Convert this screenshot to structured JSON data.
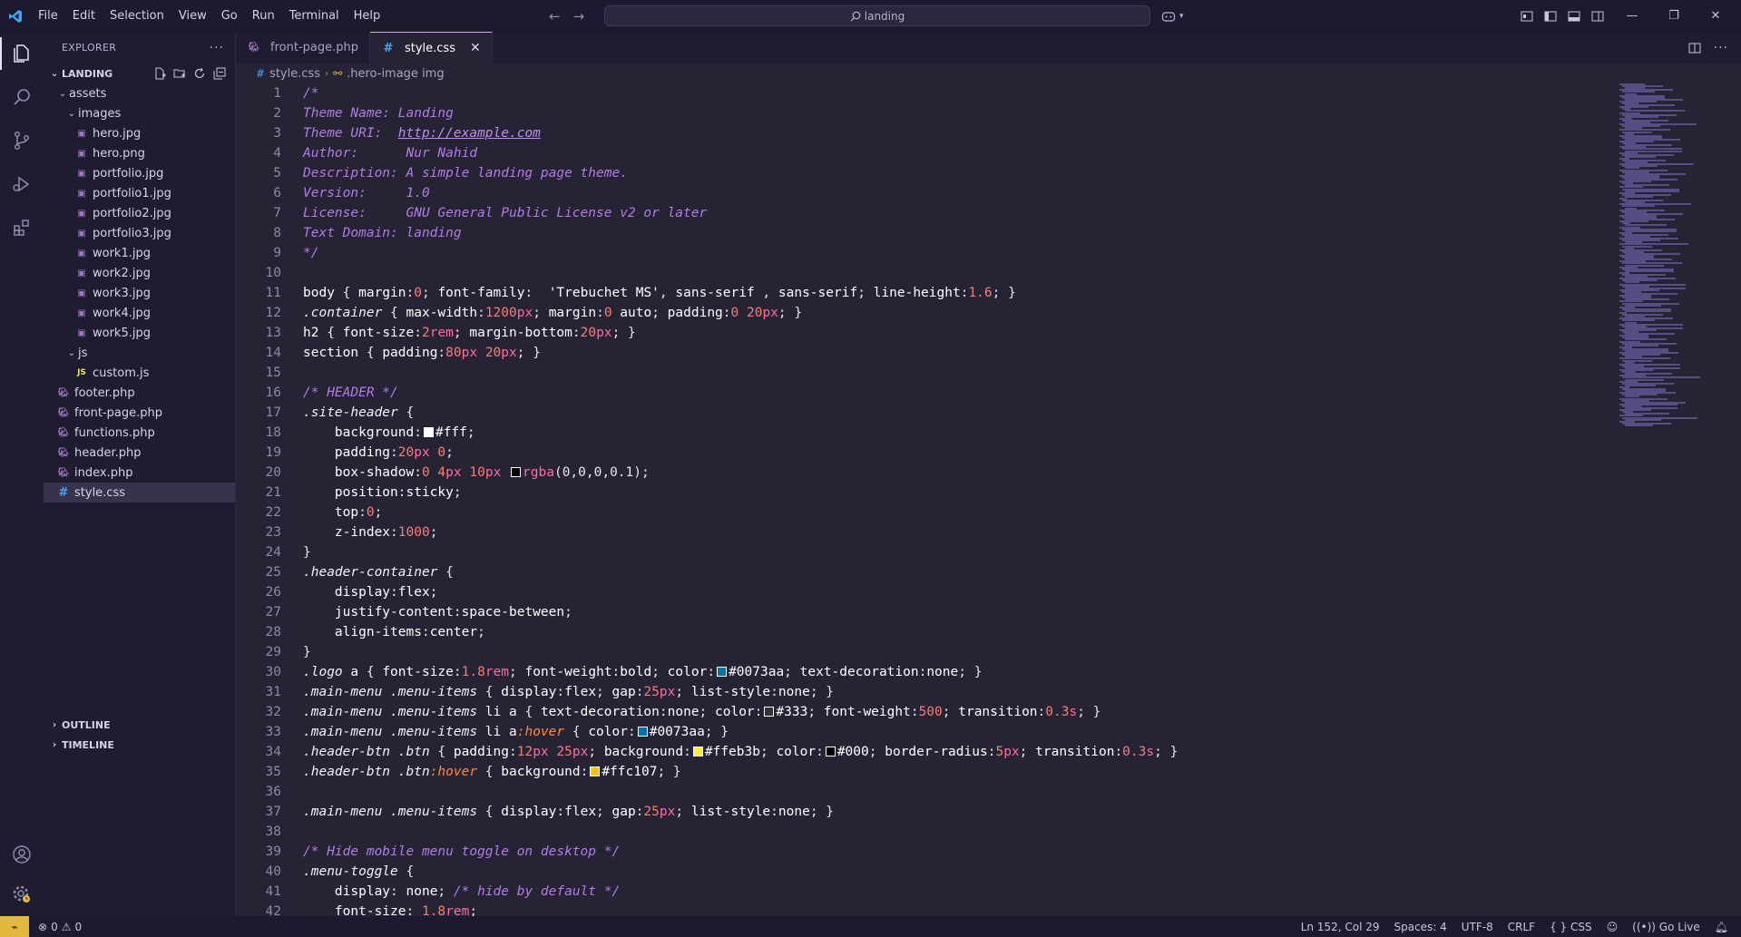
{
  "menu": [
    "File",
    "Edit",
    "Selection",
    "View",
    "Go",
    "Run",
    "Terminal",
    "Help"
  ],
  "search": {
    "text": "landing"
  },
  "sidebar": {
    "title": "EXPLORER",
    "root": "LANDING",
    "tree": [
      {
        "label": "assets",
        "type": "folder",
        "depth": 1
      },
      {
        "label": "images",
        "type": "folder",
        "depth": 2
      },
      {
        "label": "hero.jpg",
        "type": "img",
        "depth": 3
      },
      {
        "label": "hero.png",
        "type": "img",
        "depth": 3
      },
      {
        "label": "portfolio.jpg",
        "type": "img",
        "depth": 3
      },
      {
        "label": "portfolio1.jpg",
        "type": "img",
        "depth": 3
      },
      {
        "label": "portfolio2.jpg",
        "type": "img",
        "depth": 3
      },
      {
        "label": "portfolio3.jpg",
        "type": "img",
        "depth": 3
      },
      {
        "label": "work1.jpg",
        "type": "img",
        "depth": 3
      },
      {
        "label": "work2.jpg",
        "type": "img",
        "depth": 3
      },
      {
        "label": "work3.jpg",
        "type": "img",
        "depth": 3
      },
      {
        "label": "work4.jpg",
        "type": "img",
        "depth": 3
      },
      {
        "label": "work5.jpg",
        "type": "img",
        "depth": 3
      },
      {
        "label": "js",
        "type": "folder",
        "depth": 2
      },
      {
        "label": "custom.js",
        "type": "js",
        "depth": 3
      },
      {
        "label": "footer.php",
        "type": "php",
        "depth": 1
      },
      {
        "label": "front-page.php",
        "type": "php",
        "depth": 1
      },
      {
        "label": "functions.php",
        "type": "php",
        "depth": 1
      },
      {
        "label": "header.php",
        "type": "php",
        "depth": 1
      },
      {
        "label": "index.php",
        "type": "php",
        "depth": 1
      },
      {
        "label": "style.css",
        "type": "css",
        "depth": 1,
        "selected": true
      }
    ],
    "outline": "OUTLINE",
    "timeline": "TIMELINE"
  },
  "tabs": [
    {
      "label": "front-page.php",
      "icon": "php",
      "active": false
    },
    {
      "label": "style.css",
      "icon": "css",
      "active": true
    }
  ],
  "breadcrumb": {
    "file": "style.css",
    "symbol": ".hero-image img"
  },
  "colors": {
    "white": "#ffffff",
    "blue": "#0073aa",
    "dark": "#333333",
    "black": "#000000",
    "yellow": "#ffeb3b",
    "amber": "#ffc107",
    "accent": "#e2b93d"
  },
  "code": [
    [
      [
        "c",
        "/*"
      ]
    ],
    [
      [
        "c",
        "Theme Name: Landing"
      ]
    ],
    [
      [
        "c",
        "Theme URI:  "
      ],
      [
        "url",
        "http://example.com"
      ]
    ],
    [
      [
        "c",
        "Author:      Nur Nahid"
      ]
    ],
    [
      [
        "c",
        "Description: A simple landing page theme."
      ]
    ],
    [
      [
        "c",
        "Version:     1.0"
      ]
    ],
    [
      [
        "c",
        "License:     GNU General Public License v2 or later"
      ]
    ],
    [
      [
        "c",
        "Text Domain: landing"
      ]
    ],
    [
      [
        "c",
        "*/"
      ]
    ],
    [],
    [
      [
        "sel",
        "body"
      ],
      [
        "pun",
        " { "
      ],
      [
        "prop",
        "margin"
      ],
      [
        "pun",
        ":"
      ],
      [
        "num",
        "0"
      ],
      [
        "pun",
        "; "
      ],
      [
        "prop",
        "font-family"
      ],
      [
        "pun",
        ":  "
      ],
      [
        "str",
        "'Trebuchet MS'"
      ],
      [
        "pun",
        ", "
      ],
      [
        "val",
        "sans-serif"
      ],
      [
        "pun",
        " , "
      ],
      [
        "val",
        "sans-serif"
      ],
      [
        "pun",
        "; "
      ],
      [
        "prop",
        "line-height"
      ],
      [
        "pun",
        ":"
      ],
      [
        "num",
        "1.6"
      ],
      [
        "pun",
        "; }"
      ]
    ],
    [
      [
        "cls",
        ".container"
      ],
      [
        "pun",
        " { "
      ],
      [
        "prop",
        "max-width"
      ],
      [
        "pun",
        ":"
      ],
      [
        "num",
        "1200"
      ],
      [
        "unit",
        "px"
      ],
      [
        "pun",
        "; "
      ],
      [
        "prop",
        "margin"
      ],
      [
        "pun",
        ":"
      ],
      [
        "num",
        "0"
      ],
      [
        "val",
        " auto"
      ],
      [
        "pun",
        "; "
      ],
      [
        "prop",
        "padding"
      ],
      [
        "pun",
        ":"
      ],
      [
        "num",
        "0"
      ],
      [
        "num",
        " 20"
      ],
      [
        "unit",
        "px"
      ],
      [
        "pun",
        "; }"
      ]
    ],
    [
      [
        "sel",
        "h2"
      ],
      [
        "pun",
        " { "
      ],
      [
        "prop",
        "font-size"
      ],
      [
        "pun",
        ":"
      ],
      [
        "num",
        "2"
      ],
      [
        "unit",
        "rem"
      ],
      [
        "pun",
        "; "
      ],
      [
        "prop",
        "margin-bottom"
      ],
      [
        "pun",
        ":"
      ],
      [
        "num",
        "20"
      ],
      [
        "unit",
        "px"
      ],
      [
        "pun",
        "; }"
      ]
    ],
    [
      [
        "sel",
        "section"
      ],
      [
        "pun",
        " { "
      ],
      [
        "prop",
        "padding"
      ],
      [
        "pun",
        ":"
      ],
      [
        "num",
        "80"
      ],
      [
        "unit",
        "px"
      ],
      [
        "num",
        " 20"
      ],
      [
        "unit",
        "px"
      ],
      [
        "pun",
        "; }"
      ]
    ],
    [],
    [
      [
        "c",
        "/* HEADER */"
      ]
    ],
    [
      [
        "cls",
        ".site-header"
      ],
      [
        "pun",
        " {"
      ]
    ],
    [
      [
        "pun",
        "    "
      ],
      [
        "prop",
        "background"
      ],
      [
        "pun",
        ":"
      ],
      [
        "sw",
        "white"
      ],
      [
        "val",
        "#fff"
      ],
      [
        "pun",
        ";"
      ]
    ],
    [
      [
        "pun",
        "    "
      ],
      [
        "prop",
        "padding"
      ],
      [
        "pun",
        ":"
      ],
      [
        "num",
        "20"
      ],
      [
        "unit",
        "px"
      ],
      [
        "num",
        " 0"
      ],
      [
        "pun",
        ";"
      ]
    ],
    [
      [
        "pun",
        "    "
      ],
      [
        "prop",
        "box-shadow"
      ],
      [
        "pun",
        ":"
      ],
      [
        "num",
        "0"
      ],
      [
        "num",
        " 4"
      ],
      [
        "unit",
        "px"
      ],
      [
        "num",
        " 10"
      ],
      [
        "unit",
        "px"
      ],
      [
        "pun",
        " "
      ],
      [
        "sw",
        "black"
      ],
      [
        "unit",
        "rgba"
      ],
      [
        "pun",
        "(0,0,0,0.1);"
      ]
    ],
    [
      [
        "pun",
        "    "
      ],
      [
        "prop",
        "position"
      ],
      [
        "pun",
        ":"
      ],
      [
        "val",
        "sticky"
      ],
      [
        "pun",
        ";"
      ]
    ],
    [
      [
        "pun",
        "    "
      ],
      [
        "prop",
        "top"
      ],
      [
        "pun",
        ":"
      ],
      [
        "num",
        "0"
      ],
      [
        "pun",
        ";"
      ]
    ],
    [
      [
        "pun",
        "    "
      ],
      [
        "prop",
        "z-index"
      ],
      [
        "pun",
        ":"
      ],
      [
        "num",
        "1000"
      ],
      [
        "pun",
        ";"
      ]
    ],
    [
      [
        "pun",
        "}"
      ]
    ],
    [
      [
        "cls",
        ".header-container"
      ],
      [
        "pun",
        " {"
      ]
    ],
    [
      [
        "pun",
        "    "
      ],
      [
        "prop",
        "display"
      ],
      [
        "pun",
        ":"
      ],
      [
        "val",
        "flex"
      ],
      [
        "pun",
        ";"
      ]
    ],
    [
      [
        "pun",
        "    "
      ],
      [
        "prop",
        "justify-content"
      ],
      [
        "pun",
        ":"
      ],
      [
        "val",
        "space-between"
      ],
      [
        "pun",
        ";"
      ]
    ],
    [
      [
        "pun",
        "    "
      ],
      [
        "prop",
        "align-items"
      ],
      [
        "pun",
        ":"
      ],
      [
        "val",
        "center"
      ],
      [
        "pun",
        ";"
      ]
    ],
    [
      [
        "pun",
        "}"
      ]
    ],
    [
      [
        "cls",
        ".logo"
      ],
      [
        "sel",
        " a"
      ],
      [
        "pun",
        " { "
      ],
      [
        "prop",
        "font-size"
      ],
      [
        "pun",
        ":"
      ],
      [
        "num",
        "1.8"
      ],
      [
        "unit",
        "rem"
      ],
      [
        "pun",
        "; "
      ],
      [
        "prop",
        "font-weight"
      ],
      [
        "pun",
        ":"
      ],
      [
        "val",
        "bold"
      ],
      [
        "pun",
        "; "
      ],
      [
        "prop",
        "color"
      ],
      [
        "pun",
        ":"
      ],
      [
        "sw",
        "blue"
      ],
      [
        "val",
        "#0073aa"
      ],
      [
        "pun",
        "; "
      ],
      [
        "prop",
        "text-decoration"
      ],
      [
        "pun",
        ":"
      ],
      [
        "val",
        "none"
      ],
      [
        "pun",
        "; }"
      ]
    ],
    [
      [
        "cls",
        ".main-menu"
      ],
      [
        "pun",
        " "
      ],
      [
        "cls",
        ".menu-items"
      ],
      [
        "pun",
        " { "
      ],
      [
        "prop",
        "display"
      ],
      [
        "pun",
        ":"
      ],
      [
        "val",
        "flex"
      ],
      [
        "pun",
        "; "
      ],
      [
        "prop",
        "gap"
      ],
      [
        "pun",
        ":"
      ],
      [
        "num",
        "25"
      ],
      [
        "unit",
        "px"
      ],
      [
        "pun",
        "; "
      ],
      [
        "prop",
        "list-style"
      ],
      [
        "pun",
        ":"
      ],
      [
        "val",
        "none"
      ],
      [
        "pun",
        "; }"
      ]
    ],
    [
      [
        "cls",
        ".main-menu"
      ],
      [
        "pun",
        " "
      ],
      [
        "cls",
        ".menu-items"
      ],
      [
        "sel",
        " li a"
      ],
      [
        "pun",
        " { "
      ],
      [
        "prop",
        "text-decoration"
      ],
      [
        "pun",
        ":"
      ],
      [
        "val",
        "none"
      ],
      [
        "pun",
        "; "
      ],
      [
        "prop",
        "color"
      ],
      [
        "pun",
        ":"
      ],
      [
        "sw",
        "dark"
      ],
      [
        "val",
        "#333"
      ],
      [
        "pun",
        "; "
      ],
      [
        "prop",
        "font-weight"
      ],
      [
        "pun",
        ":"
      ],
      [
        "num",
        "500"
      ],
      [
        "pun",
        "; "
      ],
      [
        "prop",
        "transition"
      ],
      [
        "pun",
        ":"
      ],
      [
        "num",
        "0.3"
      ],
      [
        "unit",
        "s"
      ],
      [
        "pun",
        "; }"
      ]
    ],
    [
      [
        "cls",
        ".main-menu"
      ],
      [
        "pun",
        " "
      ],
      [
        "cls",
        ".menu-items"
      ],
      [
        "sel",
        " li a"
      ],
      [
        "pseudo",
        ":hover"
      ],
      [
        "pun",
        " { "
      ],
      [
        "prop",
        "color"
      ],
      [
        "pun",
        ":"
      ],
      [
        "sw",
        "blue"
      ],
      [
        "val",
        "#0073aa"
      ],
      [
        "pun",
        "; }"
      ]
    ],
    [
      [
        "cls",
        ".header-btn"
      ],
      [
        "pun",
        " "
      ],
      [
        "cls",
        ".btn"
      ],
      [
        "pun",
        " { "
      ],
      [
        "prop",
        "padding"
      ],
      [
        "pun",
        ":"
      ],
      [
        "num",
        "12"
      ],
      [
        "unit",
        "px"
      ],
      [
        "num",
        " 25"
      ],
      [
        "unit",
        "px"
      ],
      [
        "pun",
        "; "
      ],
      [
        "prop",
        "background"
      ],
      [
        "pun",
        ":"
      ],
      [
        "sw",
        "yellow"
      ],
      [
        "val",
        "#ffeb3b"
      ],
      [
        "pun",
        "; "
      ],
      [
        "prop",
        "color"
      ],
      [
        "pun",
        ":"
      ],
      [
        "sw",
        "black"
      ],
      [
        "val",
        "#000"
      ],
      [
        "pun",
        "; "
      ],
      [
        "prop",
        "border-radius"
      ],
      [
        "pun",
        ":"
      ],
      [
        "num",
        "5"
      ],
      [
        "unit",
        "px"
      ],
      [
        "pun",
        "; "
      ],
      [
        "prop",
        "transition"
      ],
      [
        "pun",
        ":"
      ],
      [
        "num",
        "0.3"
      ],
      [
        "unit",
        "s"
      ],
      [
        "pun",
        "; }"
      ]
    ],
    [
      [
        "cls",
        ".header-btn"
      ],
      [
        "pun",
        " "
      ],
      [
        "cls",
        ".btn"
      ],
      [
        "pseudo",
        ":hover"
      ],
      [
        "pun",
        " { "
      ],
      [
        "prop",
        "background"
      ],
      [
        "pun",
        ":"
      ],
      [
        "sw",
        "amber"
      ],
      [
        "val",
        "#ffc107"
      ],
      [
        "pun",
        "; }"
      ]
    ],
    [],
    [
      [
        "cls",
        ".main-menu"
      ],
      [
        "pun",
        " "
      ],
      [
        "cls",
        ".menu-items"
      ],
      [
        "pun",
        " { "
      ],
      [
        "prop",
        "display"
      ],
      [
        "pun",
        ":"
      ],
      [
        "val",
        "flex"
      ],
      [
        "pun",
        "; "
      ],
      [
        "prop",
        "gap"
      ],
      [
        "pun",
        ":"
      ],
      [
        "num",
        "25"
      ],
      [
        "unit",
        "px"
      ],
      [
        "pun",
        "; "
      ],
      [
        "prop",
        "list-style"
      ],
      [
        "pun",
        ":"
      ],
      [
        "val",
        "none"
      ],
      [
        "pun",
        "; }"
      ]
    ],
    [],
    [
      [
        "c",
        "/* Hide mobile menu toggle on desktop */"
      ]
    ],
    [
      [
        "cls",
        ".menu-toggle"
      ],
      [
        "pun",
        " {"
      ]
    ],
    [
      [
        "pun",
        "    "
      ],
      [
        "prop",
        "display"
      ],
      [
        "pun",
        ": "
      ],
      [
        "val",
        "none"
      ],
      [
        "pun",
        "; "
      ],
      [
        "c",
        "/* hide by default */"
      ]
    ],
    [
      [
        "pun",
        "    "
      ],
      [
        "prop",
        "font-size"
      ],
      [
        "pun",
        ": "
      ],
      [
        "num",
        "1.8"
      ],
      [
        "unit",
        "rem"
      ],
      [
        "pun",
        ";"
      ]
    ]
  ],
  "status": {
    "errors": "0",
    "warnings": "0",
    "position": "Ln 152, Col 29",
    "spaces": "Spaces: 4",
    "encoding": "UTF-8",
    "eol": "CRLF",
    "language": "CSS",
    "golive": "Go Live"
  }
}
